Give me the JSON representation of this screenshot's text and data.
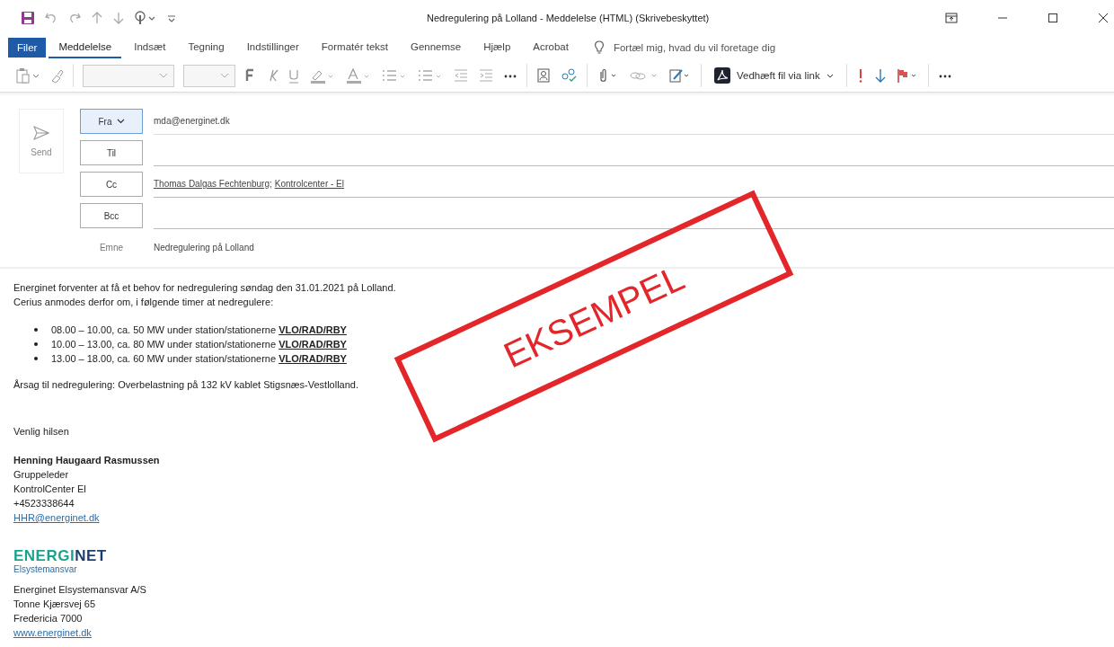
{
  "window": {
    "title": "Nedregulering på Lolland  -  Meddelelse (HTML) (Skrivebeskyttet)"
  },
  "ribbon": {
    "file_button": "Filer",
    "tabs": [
      {
        "label": "Meddelelse",
        "selected": true
      },
      {
        "label": "Indsæt",
        "selected": false
      },
      {
        "label": "Tegning",
        "selected": false
      },
      {
        "label": "Indstillinger",
        "selected": false
      },
      {
        "label": "Formatér tekst",
        "selected": false
      },
      {
        "label": "Gennemse",
        "selected": false
      },
      {
        "label": "Hjælp",
        "selected": false
      },
      {
        "label": "Acrobat",
        "selected": false
      }
    ],
    "tell_me": "Fortæl mig, hvad du vil foretage dig",
    "attach_link_button": "Vedhæft fil via link"
  },
  "header": {
    "send": "Send",
    "from": {
      "label": "Fra",
      "value": "mda@energinet.dk"
    },
    "to": {
      "label": "Til"
    },
    "cc": {
      "label": "Cc",
      "recipients": [
        {
          "name": "Thomas Dalgas Fechtenburg",
          "separator": ";"
        },
        {
          "name": "Kontrolcenter - El"
        }
      ]
    },
    "bcc": {
      "label": "Bcc"
    },
    "subject": {
      "label": "Emne",
      "value": "Nedregulering på Lolland"
    }
  },
  "body": {
    "intro": [
      "Energinet forventer at få et behov for nedregulering søndag den 31.01.2021 på Lolland.",
      "Cerius anmodes derfor om, i følgende timer at nedregulere:"
    ],
    "bullets": [
      "08.00 – 10.00, ca. 50 MW under station/stationerne **VLO/RAD/RBY**",
      "10.00 – 13.00, ca. 80 MW under station/stationerne **VLO/RAD/RBY**",
      "13.00 – 18.00, ca. 60 MW under station/stationerne **VLO/RAD/RBY**"
    ],
    "reason": "Årsag til nedregulering: Overbelastning på 132 kV kablet Stigsnæs-Vestlolland.",
    "closing": "Venlig hilsen",
    "signature": {
      "name": "Henning Haugaard Rasmussen",
      "lines": [
        "Gruppeleder",
        "KontrolCenter El",
        "+4523338644"
      ],
      "email": "HHR@energinet.dk"
    },
    "logo": {
      "wordmark": "ENERGINET",
      "tagline": "Elsystemansvar"
    },
    "company": [
      "Energinet Elsystemansvar A/S",
      "Tonne Kjærsvej 65",
      "Fredericia 7000"
    ],
    "website": "www.energinet.dk"
  },
  "stamp": {
    "text": "EKSEMPEL"
  }
}
